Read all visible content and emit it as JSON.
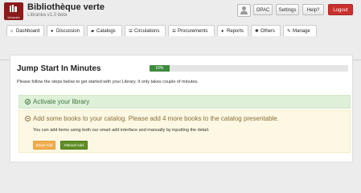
{
  "app": {
    "title": "Bibliothèque verte",
    "product": "Libranka",
    "version": "v1.0",
    "stage": "beta",
    "logo_text": "Libranka"
  },
  "topbar": {
    "opac": "OPAC",
    "settings": "Settings",
    "help": "Help?",
    "logout": "Logout"
  },
  "tabs": [
    {
      "label": "Dashboard",
      "icon": "home-icon"
    },
    {
      "label": "Discussion",
      "icon": "info-icon"
    },
    {
      "label": "Catalogs",
      "icon": "book-icon"
    },
    {
      "label": "Circulations",
      "icon": "list-icon"
    },
    {
      "label": "Procurements",
      "icon": "list-icon"
    },
    {
      "label": "Reports",
      "icon": "info-icon"
    },
    {
      "label": "Others",
      "icon": "gear-icon"
    },
    {
      "label": "Manage",
      "icon": "pencil-icon"
    }
  ],
  "jumpstart": {
    "title": "Jump Start In Minutes",
    "progress_percent": 10,
    "progress_label": "10%",
    "intro": "Please follow the steps below to get started with your Library. It only takes couple of minutes.",
    "step_activate": "Activate your library",
    "step_books": "Add some books to your catalog. Please add 4 more books to the catalog presentable.",
    "step_books_desc": "You can add items using both our smart add interface and manually by inputting the detail.",
    "smart_add": "Smart Add",
    "manual_add": "Manual Add"
  },
  "colors": {
    "logo": "#8b1a1a",
    "logout": "#c9302c",
    "progress": "#3d8b3d",
    "success_bg": "#dff0d8",
    "warning_bg": "#fcf8e3",
    "smart_add": "#f0ad4e",
    "manual_add": "#5f8f25"
  }
}
